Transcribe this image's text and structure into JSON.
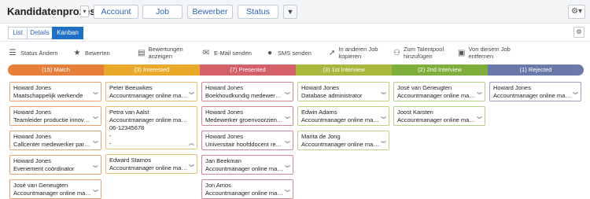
{
  "header": {
    "title": "Kandidatenprozesse",
    "title_caret": "▾",
    "nav": [
      "Account",
      "Job",
      "Bewerber",
      "Status"
    ],
    "filter_icon": "funnel-icon",
    "gear_label": "⚙▾"
  },
  "tabs": [
    {
      "label": "List",
      "active": false
    },
    {
      "label": "Details",
      "active": false
    },
    {
      "label": "Kanban",
      "active": true
    }
  ],
  "actions": [
    {
      "icon": "☰",
      "icon_name": "status-list-icon",
      "label": "Status Ändern"
    },
    {
      "icon": "★",
      "icon_name": "star-icon",
      "label": "Bewerten"
    },
    {
      "icon": "▤",
      "icon_name": "ratings-icon",
      "label": "Bewertungen anzeigen"
    },
    {
      "icon": "✉",
      "icon_name": "email-icon",
      "label": "E-Mail senden"
    },
    {
      "icon": "●",
      "icon_name": "sms-bubble-icon",
      "label": "SMS senden"
    },
    {
      "icon": "➚",
      "icon_name": "walking-person-icon",
      "label": "In anderen Job kopieren"
    },
    {
      "icon": "⚇",
      "icon_name": "people-group-icon",
      "label": "Zum Talentpool hinzufügen"
    },
    {
      "icon": "▣",
      "icon_name": "remove-document-icon",
      "label": "Von diesem Job entfernen"
    }
  ],
  "columns": [
    {
      "header": "(15) Match",
      "color": "#e57f3a",
      "border": "#e8a277",
      "cards": [
        {
          "name": "Howard Jones",
          "role": "Maatschappelijk werkende"
        },
        {
          "name": "Howard Jones",
          "role": "Teamleider productie innovatie"
        },
        {
          "name": "Howard Jones",
          "role": "Callcenter medewerker particuli..."
        },
        {
          "name": "Howard Jones",
          "role": "Evenement coördinator"
        },
        {
          "name": "José van Geneugten",
          "role": "Accountmanager online marketi..."
        }
      ]
    },
    {
      "header": "(3) Interested",
      "color": "#e9a92a",
      "border": "#e8bf6e",
      "cards": [
        {
          "name": "Peter Beeuwkes",
          "role": "Accountmanager online marke..."
        },
        {
          "name": "Petra van Aalst",
          "role": "Accountmanager online marke...",
          "extra": [
            "06-12345678",
            "-",
            "-"
          ],
          "expanded": true
        },
        {
          "name": "Edward Stamos",
          "role": "Accountmanager online marke..."
        }
      ]
    },
    {
      "header": "(7) Presented",
      "color": "#d4606a",
      "border": "#c98a91",
      "cards": [
        {
          "name": "Howard Jones",
          "role": "Boekhoudkundig medewerker"
        },
        {
          "name": "Howard Jones",
          "role": "Medewerker groenvoorziening"
        },
        {
          "name": "Howard Jones",
          "role": "Universitair hoofddocent recht..."
        },
        {
          "name": "Jan Beekman",
          "role": "Accountmanager online marke..."
        },
        {
          "name": "Jon Amos",
          "role": "Accountmanager online marke..."
        }
      ]
    },
    {
      "header": "(3) 1st Interview",
      "color": "#a9b73c",
      "border": "#c7cf87",
      "cards": [
        {
          "name": "Howard Jones",
          "role": "Database administrator"
        },
        {
          "name": "Edwin Adams",
          "role": "Accountmanager online marke..."
        },
        {
          "name": "Marita de Jong",
          "role": "Accountmanager online marke..."
        }
      ]
    },
    {
      "header": "(2) 2nd Interview",
      "color": "#7fae3c",
      "border": "#b4cf8b",
      "cards": [
        {
          "name": "José van Geneugten",
          "role": "Accountmanager online marke..."
        },
        {
          "name": "Joost Karsten",
          "role": "Accountmanager online marke..."
        }
      ]
    },
    {
      "header": "(1) Rejected",
      "color": "#6a79a9",
      "border": "#9aa2c2",
      "cards": [
        {
          "name": "Howard Jones",
          "role": "Accountmanager online marke..."
        }
      ]
    }
  ]
}
